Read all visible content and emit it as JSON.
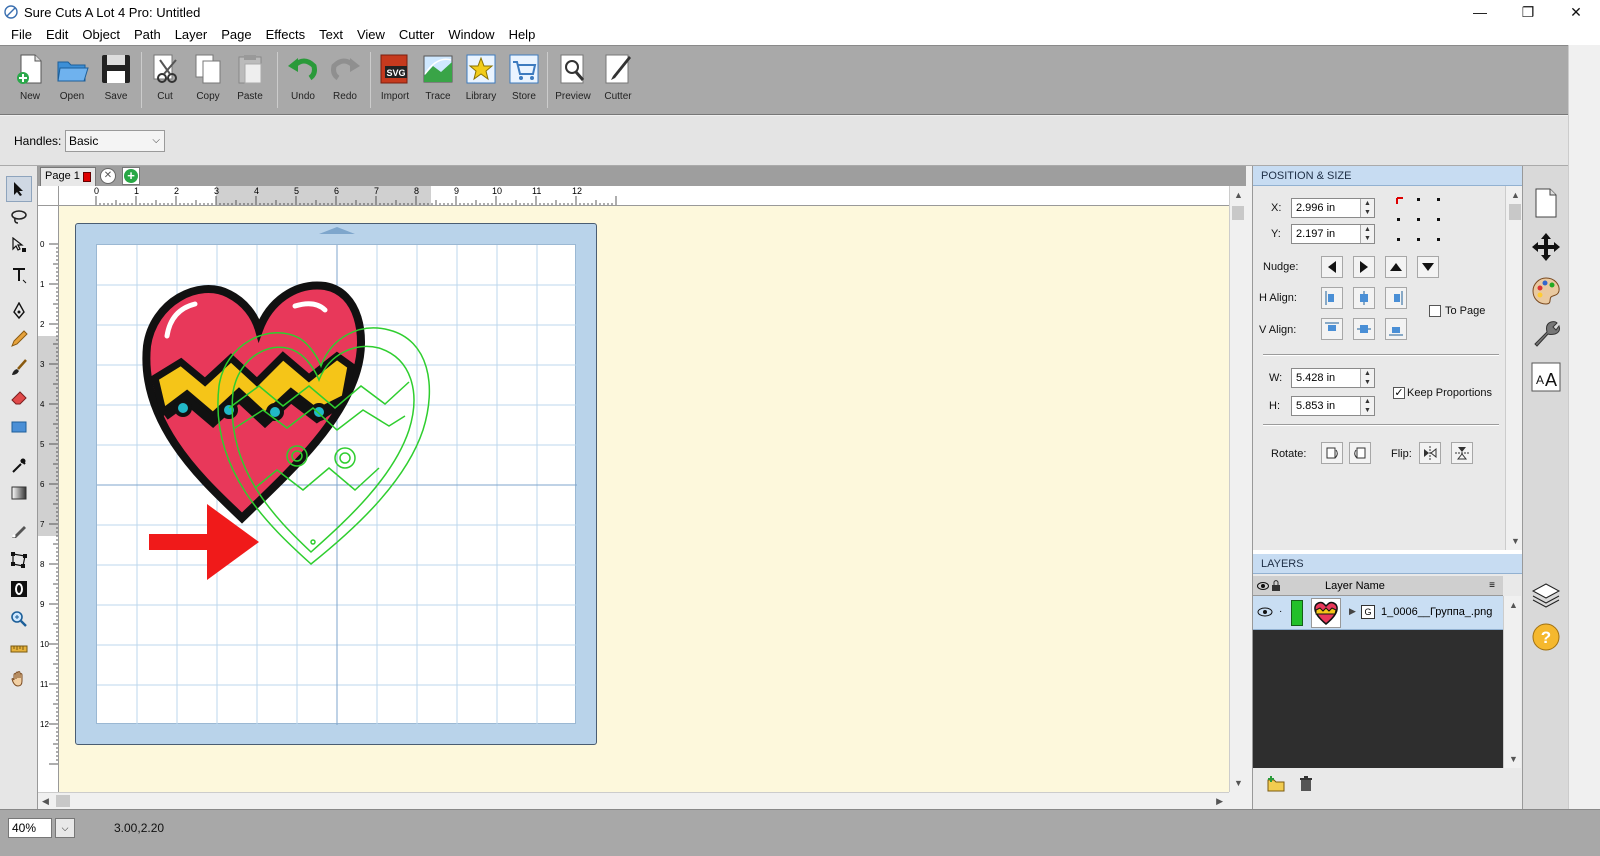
{
  "window": {
    "title": "Sure Cuts A Lot 4 Pro: Untitled",
    "minimize": "—",
    "maximize": "❐",
    "close": "✕"
  },
  "menu": [
    "File",
    "Edit",
    "Object",
    "Path",
    "Layer",
    "Page",
    "Effects",
    "Text",
    "View",
    "Cutter",
    "Window",
    "Help"
  ],
  "toolbar": {
    "new": "New",
    "open": "Open",
    "save": "Save",
    "cut": "Cut",
    "copy": "Copy",
    "paste": "Paste",
    "undo": "Undo",
    "redo": "Redo",
    "import": "Import",
    "trace": "Trace",
    "library": "Library",
    "store": "Store",
    "preview": "Preview",
    "cutter": "Cutter",
    "import_badge": "SVG"
  },
  "handles": {
    "label": "Handles:",
    "value": "Basic"
  },
  "page_tab": {
    "label": "Page 1",
    "close": "✕",
    "add": "+"
  },
  "ruler": {
    "h_ticks": [
      "0",
      "1",
      "2",
      "3",
      "4",
      "5",
      "6",
      "7",
      "8",
      "9",
      "10",
      "11",
      "12"
    ],
    "v_ticks": [
      "0",
      "1",
      "2",
      "3",
      "4",
      "5",
      "6",
      "7",
      "8",
      "9",
      "10",
      "11",
      "12"
    ]
  },
  "position_size": {
    "header": "POSITION & SIZE",
    "x_label": "X:",
    "x_value": "2.996 in",
    "y_label": "Y:",
    "y_value": "2.197 in",
    "nudge_label": "Nudge:",
    "halign_label": "H Align:",
    "valign_label": "V Align:",
    "to_page_label": "To Page",
    "w_label": "W:",
    "w_value": "5.428 in",
    "h_label": "H:",
    "h_value": "5.853 in",
    "keep_proportions_label": "Keep Proportions",
    "keep_proportions_checked": true,
    "to_page_checked": false,
    "rotate_label": "Rotate:",
    "flip_label": "Flip:"
  },
  "layers": {
    "header": "LAYERS",
    "col_name": "Layer Name",
    "rows": [
      {
        "name": "1_0006__Группа_.png",
        "group_badge": "G",
        "color": "#22c02a"
      }
    ]
  },
  "status": {
    "zoom": "40%",
    "coords": "3.00,2.20"
  },
  "colors": {
    "heart_fill": "#e8385a",
    "band_fill": "#f5c518",
    "dot_fill": "#22b8c8",
    "cut_outline": "#2fce2f",
    "arrow": "#f01a1a",
    "mat": "#b9d3ea",
    "canvas": "#fdf8dc"
  }
}
